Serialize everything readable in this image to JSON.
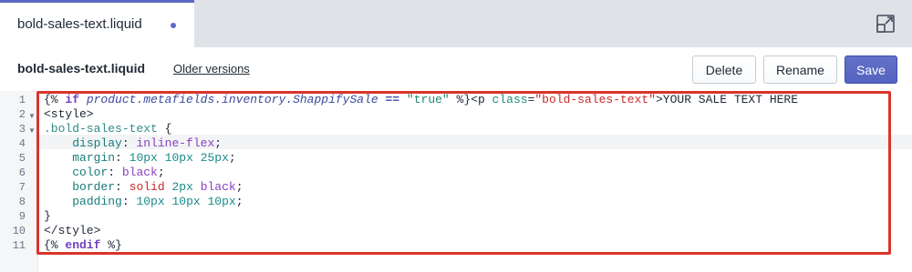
{
  "tabs": [
    {
      "label": "bold-sales-text.liquid",
      "unsaved": true
    }
  ],
  "header": {
    "file_name": "bold-sales-text.liquid",
    "older_versions": "Older versions",
    "delete_label": "Delete",
    "rename_label": "Rename",
    "save_label": "Save"
  },
  "editor": {
    "line_numbers": [
      "1",
      "2",
      "3",
      "4",
      "5",
      "6",
      "7",
      "8",
      "9",
      "10",
      "11"
    ],
    "lines": [
      "{% if product.metafields.inventory.ShappifySale == \"true\" %}<p class=\"bold-sales-text\">YOUR SALE TEXT HERE",
      "<style>",
      ".bold-sales-text {",
      "    display: inline-flex;",
      "    margin: 10px 10px 25px;",
      "    color: black;",
      "    border: solid 2px black;",
      "    padding: 10px 10px 10px;",
      "}",
      "</style>",
      "{% endif %}"
    ],
    "fold_lines": [
      2,
      3
    ]
  },
  "colors": {
    "accent": "#5c6ac4",
    "highlight_border": "#d9352a",
    "tab_bar": "#dfe3e8"
  }
}
